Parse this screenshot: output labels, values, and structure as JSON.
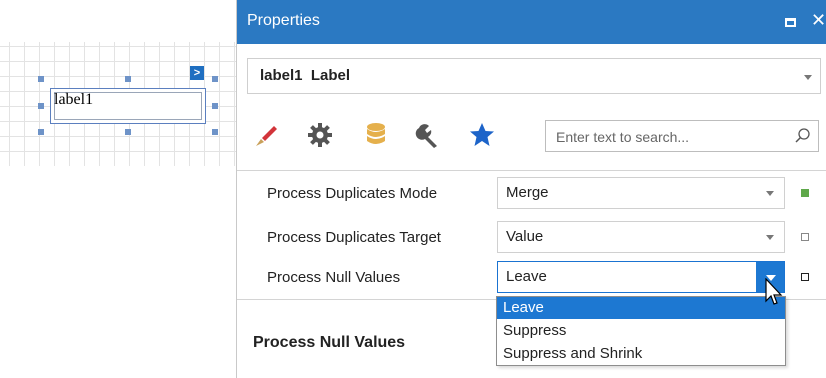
{
  "designer": {
    "label_text": "label1",
    "smart_tag_glyph": ">"
  },
  "properties": {
    "title": "Properties",
    "object_selector": {
      "name": "label1",
      "type": "Label"
    },
    "tabs": [
      "appearance-icon",
      "gear-icon",
      "database-icon",
      "wrench-icon",
      "star-icon"
    ],
    "search_placeholder": "Enter text to search...",
    "rows": [
      {
        "name": "Process Duplicates Mode",
        "value": "Merge"
      },
      {
        "name": "Process Duplicates Target",
        "value": "Value"
      },
      {
        "name": "Process Null Values",
        "value": "Leave"
      }
    ],
    "dropdown_options": [
      "Leave",
      "Suppress",
      "Suppress and Shrink"
    ],
    "selected_option": "Leave",
    "description_title": "Process Null Values"
  },
  "colors": {
    "titlebar": "#2b79c2",
    "accent": "#1d78d2",
    "marker_green": "#5fa84a"
  }
}
